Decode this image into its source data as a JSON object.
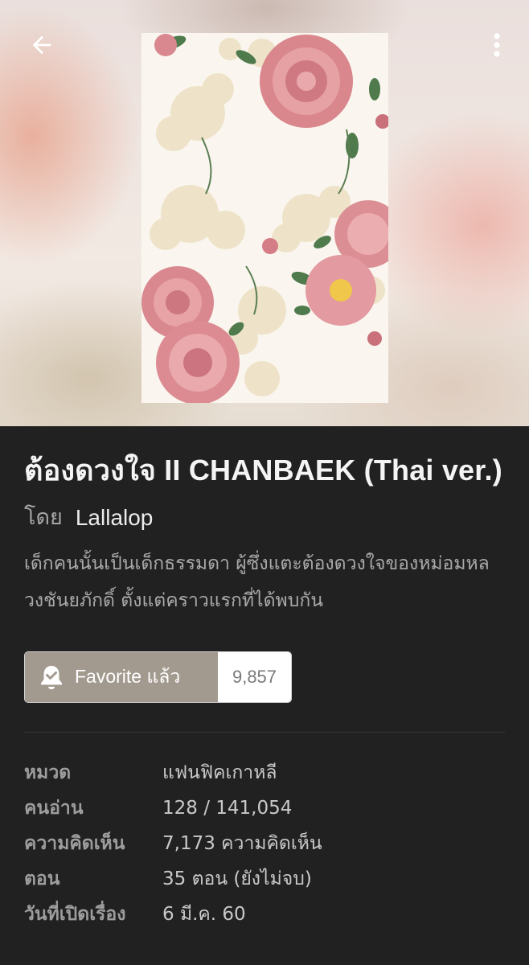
{
  "header": {
    "back_icon": "arrow-left-icon",
    "more_icon": "more-vertical-icon"
  },
  "novel": {
    "title": "ต้องดวงใจ II CHANBAEK (Thai ver.)",
    "author_prefix": "โดย",
    "author_name": "Lallalop",
    "synopsis": "เด็กคนนั้นเป็นเด็กธรรมดา ผู้ซึ่งแตะต้องดวงใจของหม่อมหลวงชันยภักดิ์ ตั้งแต่คราวแรกที่ได้พบกัน"
  },
  "favorite": {
    "icon": "bell-check-icon",
    "label": "Favorite แล้ว",
    "count": "9,857"
  },
  "info": [
    {
      "label": "หมวด",
      "value": "แฟนฟิคเกาหลี"
    },
    {
      "label": "คนอ่าน",
      "value": "128 / 141,054"
    },
    {
      "label": "ความคิดเห็น",
      "value": "7,173 ความคิดเห็น"
    },
    {
      "label": "ตอน",
      "value": "35 ตอน (ยังไม่จบ)"
    },
    {
      "label": "วันที่เปิดเรื่อง",
      "value": "6 มี.ค. 60"
    }
  ],
  "colors": {
    "background": "#212121",
    "favorite_button": "#a39a8f",
    "text_primary": "#f4f4f4",
    "text_secondary": "#a9a9a9"
  }
}
